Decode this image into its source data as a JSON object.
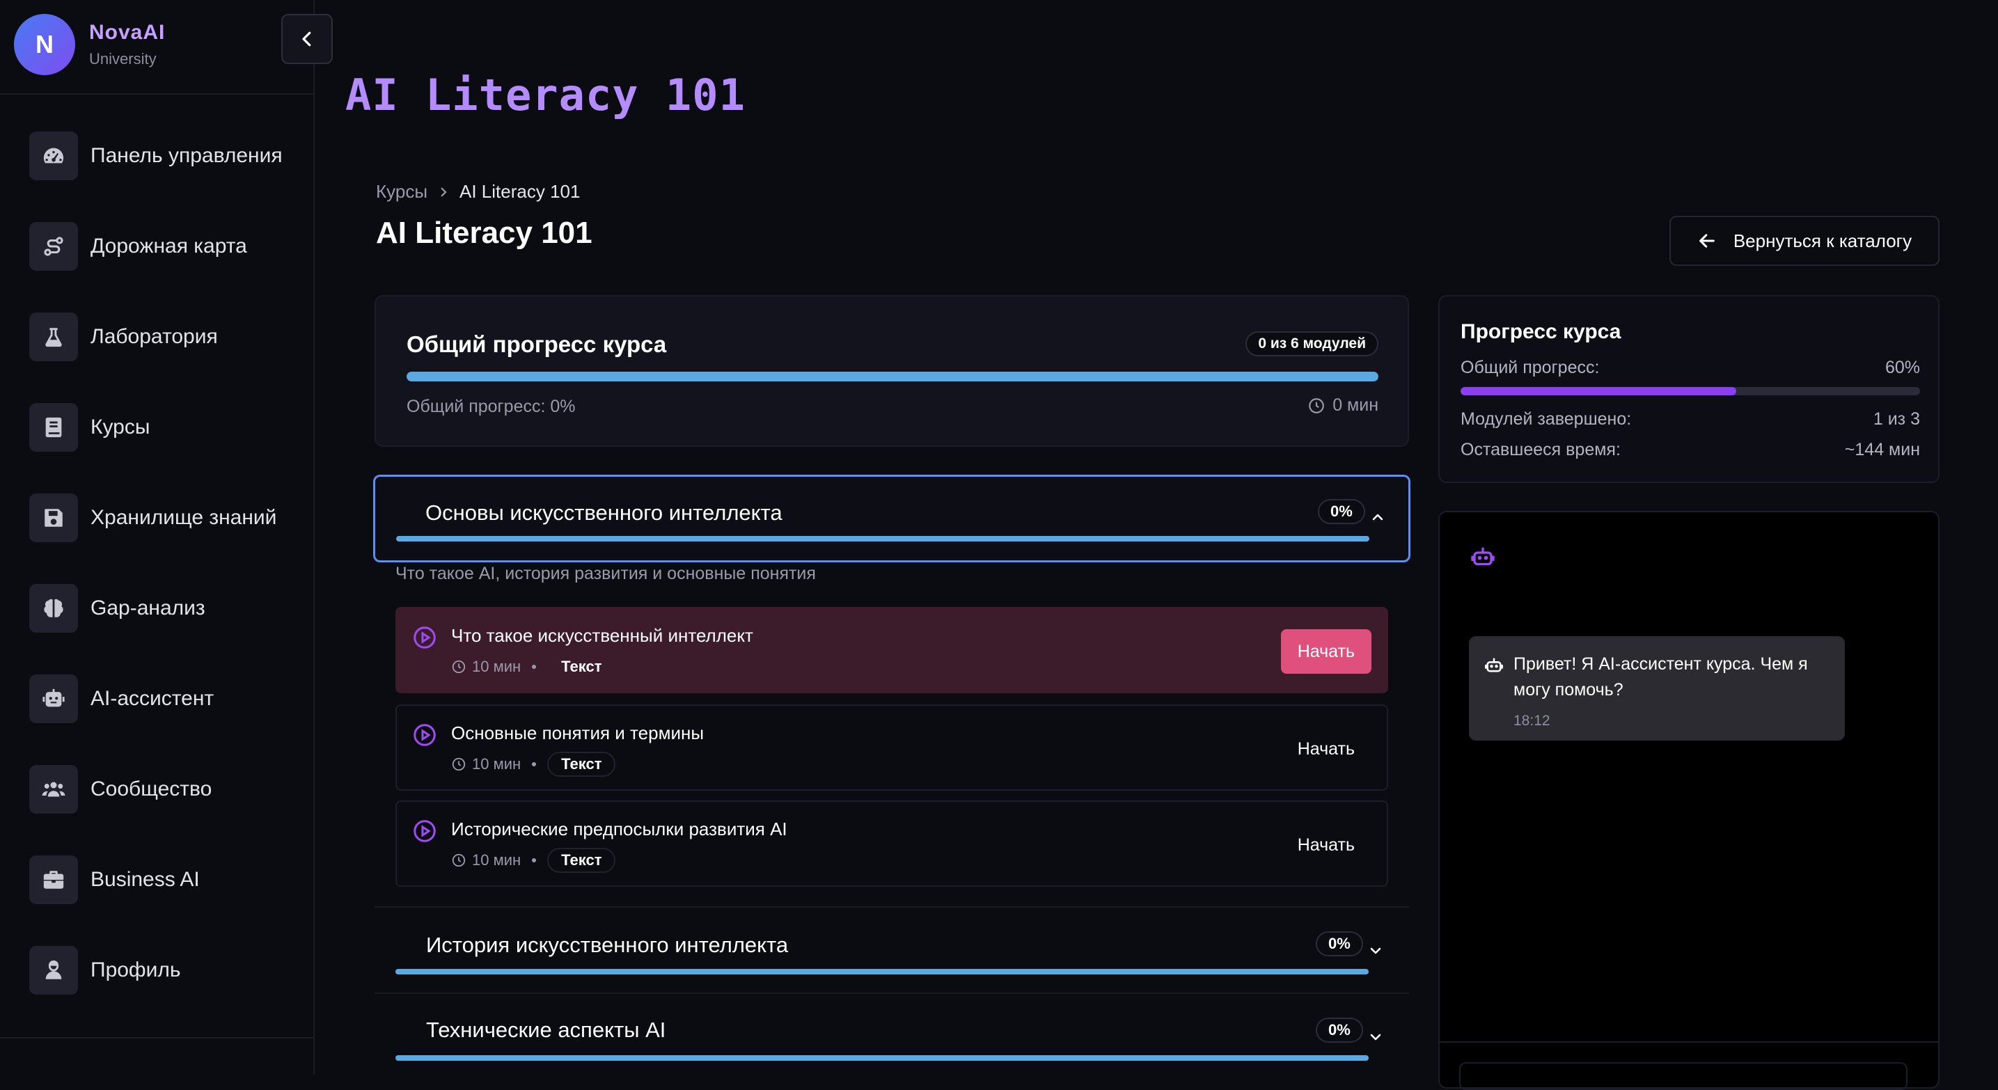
{
  "brand": {
    "initial": "N",
    "name": "NovaAI",
    "subtitle": "University"
  },
  "sidebar": {
    "items": [
      {
        "label": "Панель управления",
        "icon": "gauge-icon"
      },
      {
        "label": "Дорожная карта",
        "icon": "route-icon"
      },
      {
        "label": "Лаборатория",
        "icon": "flask-icon"
      },
      {
        "label": "Курсы",
        "icon": "book-icon"
      },
      {
        "label": "Хранилище знаний",
        "icon": "save-icon"
      },
      {
        "label": "Gap-анализ",
        "icon": "brain-icon"
      },
      {
        "label": "AI-ассистент",
        "icon": "robot-icon"
      },
      {
        "label": "Сообщество",
        "icon": "users-icon"
      },
      {
        "label": "Business AI",
        "icon": "briefcase-icon"
      },
      {
        "label": "Профиль",
        "icon": "user-icon"
      }
    ]
  },
  "header": {
    "logo_title": "AI Literacy 101"
  },
  "breadcrumb": {
    "root": "Курсы",
    "current": "AI Literacy 101"
  },
  "course": {
    "title": "AI Literacy 101",
    "back_label": "Вернуться к каталогу"
  },
  "overall": {
    "title": "Общий прогресс курса",
    "badge": "0 из 6 модулей",
    "progress_text": "Общий прогресс: 0%",
    "time": "0 мин"
  },
  "modules": [
    {
      "title": "Основы искусственного интеллекта",
      "percent": "0%",
      "description": "Что такое AI, история развития и основные понятия",
      "lessons": [
        {
          "title": "Что такое искусственный интеллект",
          "duration": "10 мин",
          "type": "Текст",
          "action": "Начать"
        },
        {
          "title": "Основные понятия и термины",
          "duration": "10 мин",
          "type": "Текст",
          "action": "Начать"
        },
        {
          "title": "Исторические предпосылки развития AI",
          "duration": "10 мин",
          "type": "Текст",
          "action": "Начать"
        }
      ]
    },
    {
      "title": "История искусственного интеллекта",
      "percent": "0%"
    },
    {
      "title": "Технические аспекты AI",
      "percent": "0%"
    }
  ],
  "course_progress": {
    "title": "Прогресс курса",
    "overall_label": "Общий прогресс:",
    "overall_value": "60%",
    "overall_fraction": 0.6,
    "modules_label": "Модулей завершено:",
    "modules_value": "1 из 3",
    "remaining_label": "Оставшееся время:",
    "remaining_value": "~144 мин"
  },
  "chat": {
    "message": "Привет! Я AI-ассистент курса. Чем я могу помочь?",
    "time": "18:12"
  },
  "colors": {
    "accent_purple": "#8a3ff0",
    "progress_blue": "#5aa9e0",
    "start_pink": "#e0507d",
    "active_lesson_bg": "#3c1b2a",
    "focus_border": "#5b8ef6"
  }
}
